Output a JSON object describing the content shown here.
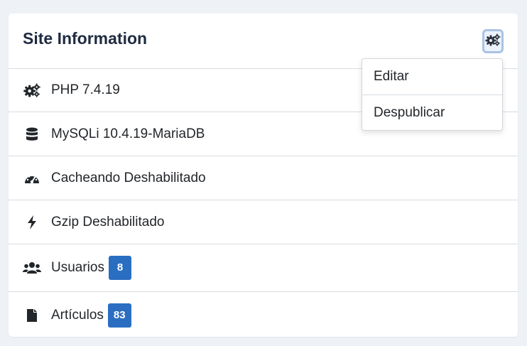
{
  "card": {
    "title": "Site Information",
    "settings_icon": "gears-icon"
  },
  "rows": [
    {
      "icon": "gears-icon",
      "label": "PHP 7.4.19"
    },
    {
      "icon": "database-icon",
      "label": "MySQLi 10.4.19-MariaDB"
    },
    {
      "icon": "speedometer-icon",
      "label": "Cacheando Deshabilitado"
    },
    {
      "icon": "bolt-icon",
      "label": "Gzip Deshabilitado"
    },
    {
      "icon": "users-icon",
      "label": "Usuarios",
      "badge": "8"
    },
    {
      "icon": "file-icon",
      "label": "Artículos",
      "badge": "83"
    }
  ],
  "dropdown": {
    "items": [
      {
        "label": "Editar"
      },
      {
        "label": "Despublicar"
      }
    ]
  },
  "colors": {
    "badge": "#2a6ec2",
    "title": "#1e2b40",
    "background": "#eef2f7"
  }
}
